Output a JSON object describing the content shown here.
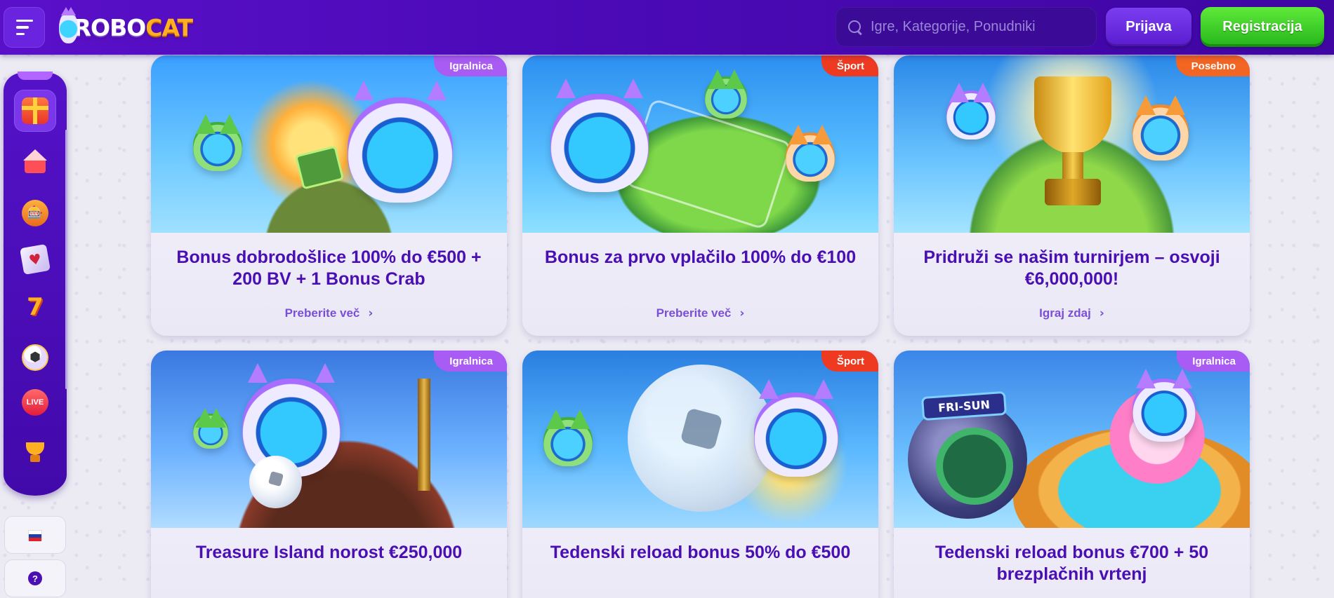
{
  "header": {
    "logo_text_robo": "ROBO",
    "logo_text_cat": "CAT",
    "search_placeholder": "Igre, Kategorije, Ponudniki",
    "login_label": "Prijava",
    "register_label": "Registracija"
  },
  "sidebar": {
    "items": [
      {
        "name": "promotions",
        "icon": "gift-icon",
        "active": true
      },
      {
        "name": "home",
        "icon": "house-icon"
      },
      {
        "name": "slots",
        "icon": "slot-machine-icon"
      },
      {
        "name": "table-games",
        "icon": "cards-icon"
      },
      {
        "name": "jackpot",
        "icon": "lucky-seven-icon"
      },
      {
        "name": "sport",
        "icon": "soccer-ball-icon"
      },
      {
        "name": "live-casino",
        "icon": "live-icon",
        "label": "LIVE"
      },
      {
        "name": "tournaments",
        "icon": "trophy-icon"
      }
    ],
    "language_flag": "slovenia-flag-icon",
    "help_label": "?"
  },
  "promos": [
    {
      "badge": "Igralnica",
      "badge_color": "#a95cf4",
      "title": "Bonus dobrodošlice 100% do €500 + 200 BV + 1 Bonus Crab",
      "link": "Preberite več"
    },
    {
      "badge": "Šport",
      "badge_color": "#ef3a22",
      "title": "Bonus za prvo vplačilo 100% do €100",
      "link": "Preberite več"
    },
    {
      "badge": "Posebno",
      "badge_color": "#f26522",
      "title": "Pridruži se našim turnirjem – osvoji €6,000,000!",
      "link": "Igraj zdaj"
    },
    {
      "badge": "Igralnica",
      "badge_color": "#a95cf4",
      "title": "Treasure Island norost €250,000",
      "link": ""
    },
    {
      "badge": "Šport",
      "badge_color": "#ef3a22",
      "title": "Tedenski reload bonus 50% do €500",
      "link": ""
    },
    {
      "badge": "Igralnica",
      "badge_color": "#a95cf4",
      "title": "Tedenski reload bonus €700 + 50 brezplačnih vrtenj",
      "link": "",
      "art_sign": "FRI-SUN"
    }
  ],
  "colors": {
    "header_bg": "#4c0ab8",
    "accent_purple": "#4a0fb3",
    "register_green": "#24b51a",
    "page_bg": "#ecebf3"
  }
}
